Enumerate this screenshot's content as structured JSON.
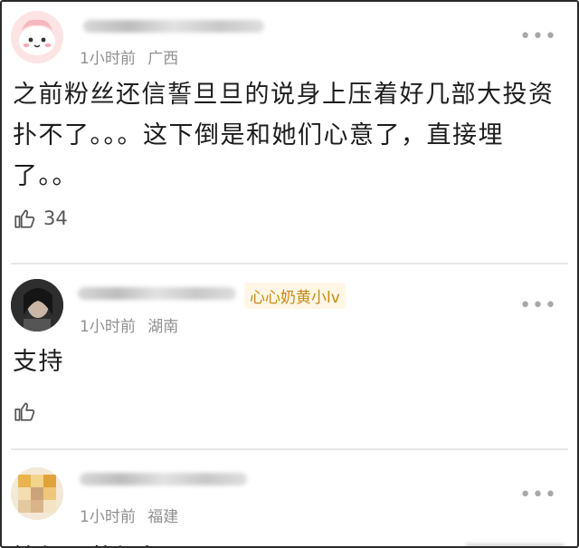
{
  "comments": [
    {
      "time": "1小时前",
      "location": "广西",
      "more_label": "•••",
      "text": "之前粉丝还信誓旦旦的说身上压着好几部大投资扑不了。。。这下倒是和她们心意了，直接埋了。。",
      "likes": "34",
      "like_icon": "thumbs-up-icon"
    },
    {
      "badge": "心心奶黄小lv",
      "time": "1小时前",
      "location": "湖南",
      "more_label": "•••",
      "text": "支持",
      "likes": "",
      "like_icon": "thumbs-up-icon"
    },
    {
      "time": "1小时前",
      "location": "福建",
      "more_label": "•••",
      "text": "捷径可的福报"
    }
  ],
  "colors": {
    "badge": "#c58a12",
    "meta": "#8f8f8f",
    "text": "#1c1c1c"
  }
}
